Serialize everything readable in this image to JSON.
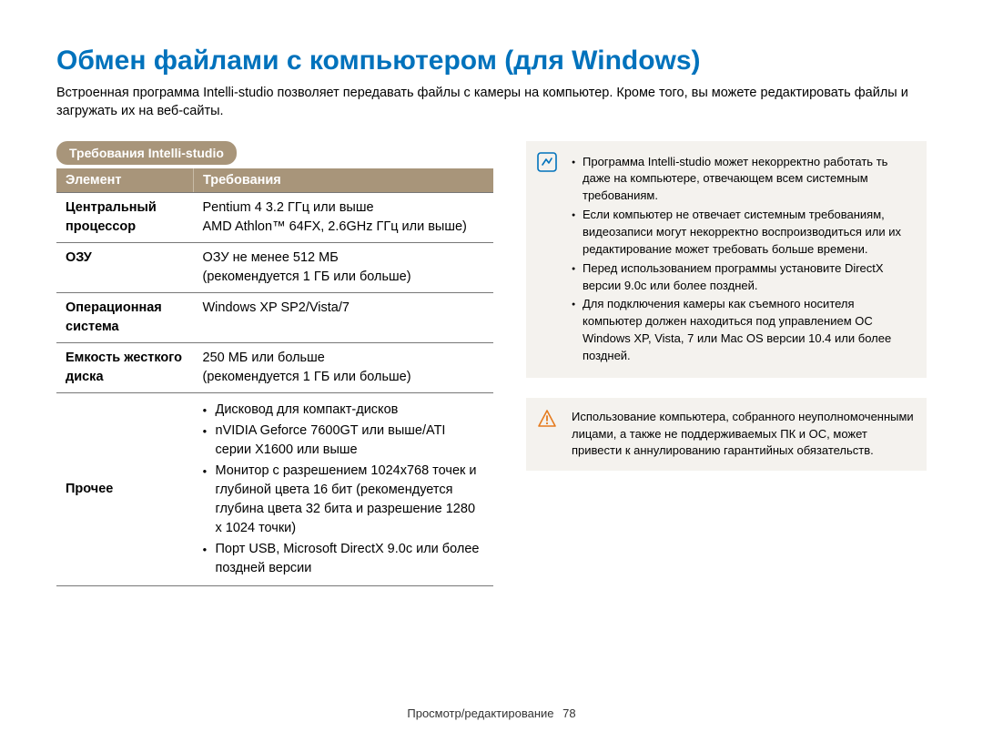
{
  "title": "Обмен файлами с компьютером (для Windows)",
  "intro": "Встроенная программа Intelli-studio позволяет передавать файлы с камеры на компьютер. Кроме того, вы можете редактировать файлы и загружать их на веб-сайты.",
  "section_label": "Требования Intelli-studio",
  "table": {
    "head_element": "Элемент",
    "head_requirements": "Требования",
    "rows": {
      "cpu": {
        "label": "Центральный процессор",
        "line1": "Pentium 4 3.2 ГГц или выше",
        "line2": "AMD Athlon™ 64FX, 2.6GHz ГГц или выше)"
      },
      "ram": {
        "label": "ОЗУ",
        "line1": "ОЗУ не менее 512 МБ",
        "line2": "(рекомендуется 1 ГБ или больше)"
      },
      "os": {
        "label": "Операционная система",
        "value": "Windows XP SP2/Vista/7"
      },
      "hdd": {
        "label": "Емкость жесткого диска",
        "line1": "250 МБ или больше",
        "line2": "(рекомендуется 1 ГБ или больше)"
      },
      "other": {
        "label": "Прочее",
        "b1": "Дисковод для компакт-дисков",
        "b2": "nVIDIA Geforce 7600GT или выше/ATI серии X1600 или выше",
        "b3": "Монитор с разрешением 1024x768 точек и глубиной цвета 16 бит (рекомендуется глубина цвета 32 бита и разрешение 1280 x 1024 точки)",
        "b4": "Порт USB, Microsoft DirectX 9.0c или более поздней версии"
      }
    }
  },
  "info": {
    "n1": "Программа Intelli-studio может некорректно работать ть даже на компьютере, отвечающем всем системным требованиям.",
    "n2": "Если компьютер не отвечает системным требованиям, видеозаписи могут некорректно воспроизводиться или их редактирование может требовать больше времени.",
    "n3": "Перед использованием программы установите DirectX версии 9.0c или более поздней.",
    "n4": "Для подключения камеры как съемного носителя компьютер должен находиться под управлением ОС Windows XP, Vista, 7 или Mac OS версии 10.4 или более поздней."
  },
  "warning": "Использование компьютера, собранного неуполномоченными лицами, а также не поддерживаемых ПК и ОС, может привести к аннулированию гарантийных обязательств.",
  "footer": {
    "section": "Просмотр/редактирование",
    "page": "78"
  }
}
